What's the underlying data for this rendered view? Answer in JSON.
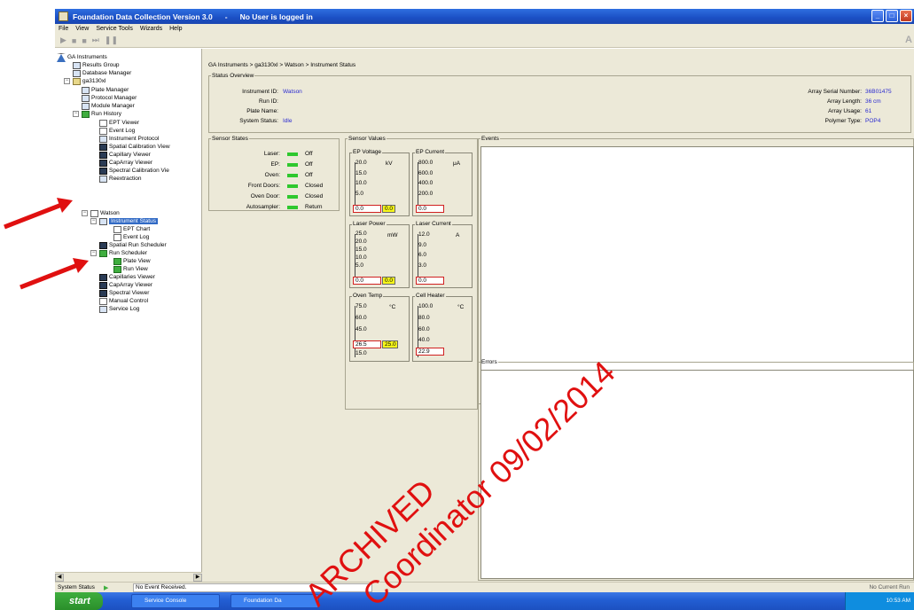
{
  "window": {
    "title": "Foundation Data Collection Version 3.0",
    "separator": "-",
    "user_status": "No User is logged in",
    "min_label": "_",
    "max_label": "□",
    "close_label": "×"
  },
  "menu": [
    "File",
    "View",
    "Service Tools",
    "Wizards",
    "Help"
  ],
  "toolbar": {
    "right_label": "A"
  },
  "tree": {
    "root": "GA Instruments",
    "results_group": "Results Group",
    "database_manager": "Database Manager",
    "instrument_node": "ga3130xl",
    "plate_manager": "Plate Manager",
    "protocol_manager": "Protocol Manager",
    "module_manager": "Module Manager",
    "run_history": "Run History",
    "ept_viewer": "EPT Viewer",
    "event_log": "Event Log",
    "instrument_protocol": "Instrument Protocol",
    "spatial_cal_viewer": "Spatial Calibration View",
    "capillary_viewer": "Capillary Viewer",
    "caparray_viewer": "CapArray Viewer",
    "spectral_cal_viewer": "Spectral Calibration Vie",
    "reextraction": "Reextraction",
    "watson": "Watson",
    "instrument_status": "Instrument Status",
    "ept_chart": "EPT Chart",
    "event_log2": "Event Log",
    "spatial_run_scheduler": "Spatial Run Scheduler",
    "run_scheduler": "Run Scheduler",
    "plate_view": "Plate View",
    "run_view": "Run View",
    "capillaries_viewer": "Capillaries Viewer",
    "caparray_viewer2": "CapArray Viewer",
    "spectral_viewer": "Spectral Viewer",
    "manual_control": "Manual Control",
    "service_log": "Service Log"
  },
  "breadcrumb": "GA Instruments > ga3130xl > Watson > Instrument Status",
  "status_overview": {
    "legend": "Status Overview",
    "instrument_id_label": "Instrument ID:",
    "instrument_id": "Watson",
    "run_id_label": "Run ID:",
    "run_id": "",
    "plate_name_label": "Plate Name:",
    "plate_name": "",
    "system_status_label": "System Status:",
    "system_status": "Idle",
    "array_serial_label": "Array Serial Number:",
    "array_serial": "36B01475",
    "array_length_label": "Array Length:",
    "array_length": "36 cm",
    "array_usage_label": "Array Usage:",
    "array_usage": "61",
    "polymer_type_label": "Polymer Type:",
    "polymer_type": "POP4"
  },
  "sensor_states": {
    "legend": "Sensor States",
    "laser_label": "Laser:",
    "laser": "Off",
    "ep_label": "EP:",
    "ep": "Off",
    "oven_label": "Oven:",
    "oven": "Off",
    "front_doors_label": "Front Doors:",
    "front_doors": "Closed",
    "oven_door_label": "Oven Door:",
    "oven_door": "Closed",
    "autosampler_label": "Autosampler:",
    "autosampler": "Return"
  },
  "sensor_values": {
    "legend": "Sensor Values",
    "ep_voltage": {
      "title": "EP Voltage",
      "unit": "kV",
      "ticks": [
        "20.0",
        "15.0",
        "10.0",
        "5.0"
      ],
      "actual": "0.0",
      "setpoint": "0.0"
    },
    "ep_current": {
      "title": "EP Current",
      "unit": "μA",
      "ticks": [
        "800.0",
        "600.0",
        "400.0",
        "200.0"
      ],
      "actual": "0.0"
    },
    "laser_power": {
      "title": "Laser Power",
      "unit": "mW",
      "ticks": [
        "25.0",
        "20.0",
        "15.0",
        "10.0",
        "5.0"
      ],
      "actual": "0.0",
      "setpoint": "0.0"
    },
    "laser_current": {
      "title": "Laser Current",
      "unit": "A",
      "ticks": [
        "12.0",
        "9.0",
        "6.0",
        "3.0"
      ],
      "actual": "0.0"
    },
    "oven_temp": {
      "title": "Oven Temp",
      "unit": "°C",
      "ticks": [
        "75.0",
        "60.0",
        "45.0",
        "15.0"
      ],
      "actual": "26.5",
      "setpoint": "25.0"
    },
    "cell_heater": {
      "title": "Cell Heater",
      "unit": "°C",
      "ticks": [
        "100.0",
        "80.0",
        "60.0",
        "40.0"
      ],
      "actual": "22.9"
    }
  },
  "events": {
    "legend": "Events"
  },
  "errors": {
    "legend": "Errors"
  },
  "statusbar": {
    "system_status": "System Status",
    "message": "No Event Received.",
    "right": "No Current Run"
  },
  "taskbar": {
    "start": "start",
    "task1": "Service Console",
    "task2": "Foundation Da",
    "clock": "10:53 AM"
  },
  "watermark": {
    "line1": "ARCHIVED",
    "line2": "Coordinator 09/02/2014"
  },
  "colors": {
    "accent": "#316ac5",
    "led": "#2ec82e",
    "setpoint": "#f7f71a",
    "value_text": "#2a2ad0",
    "arrow": "#e01010"
  }
}
